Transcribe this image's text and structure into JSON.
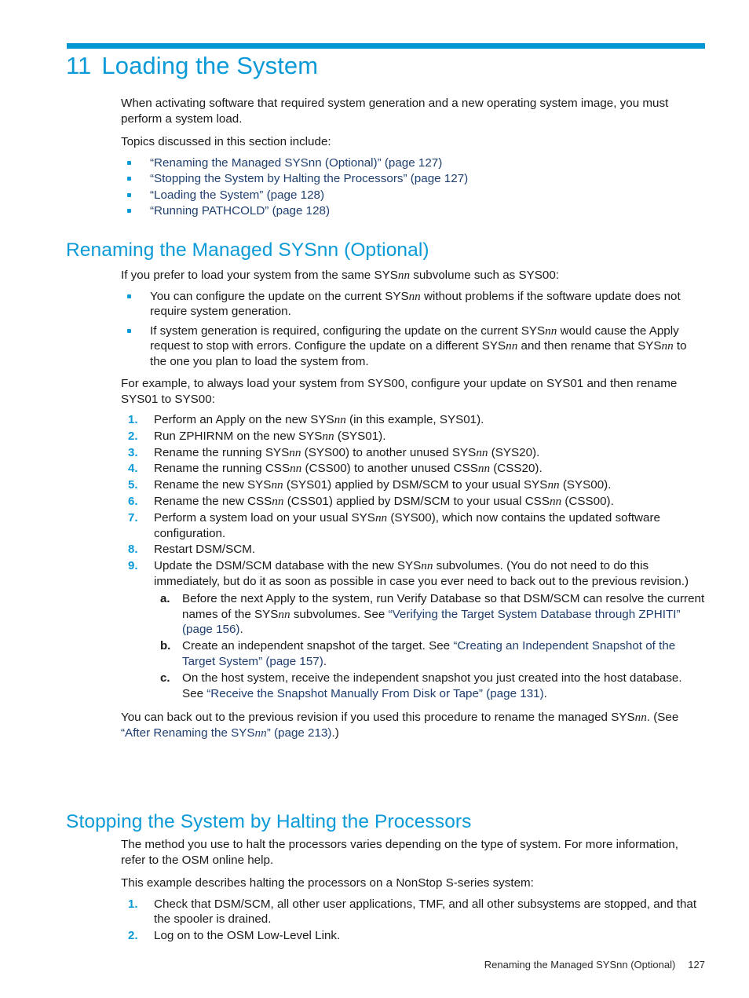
{
  "page": {
    "accent_color": "#0a9ad8",
    "rule_color": "#0096d2",
    "xref_color": "#1f3f6e",
    "body_color": "#1a1a1a"
  },
  "chapter": {
    "number": "11",
    "title": "Loading the System"
  },
  "intro": {
    "paragraph": "When activating software that required system generation and a new operating system image, you must perform a system load.",
    "topics_lead": "Topics discussed in this section include:",
    "topics": [
      "“Renaming the Managed SYSnn (Optional)” (page 127)",
      "“Stopping the System by Halting the Processors” (page 127)",
      "“Loading the System” (page 128)",
      "“Running PATHCOLD” (page 128)"
    ]
  },
  "section_rename": {
    "heading": "Renaming the Managed SYSnn (Optional)",
    "lead_a": "If you prefer to load your system from the same SYS",
    "lead_nn": "nn",
    "lead_b": " subvolume such as SYS00:",
    "bullets": [
      {
        "a": "You can configure the update on the current SYS",
        "nn": "nn",
        "b": " without problems if the software update does not require system generation."
      },
      {
        "a": "If system generation is required, configuring the update on the current SYS",
        "nn": "nn",
        "b": " would cause the Apply request to stop with errors. Configure the update on a different SYS",
        "nn2": "nn",
        "c": " and then rename that SYS",
        "nn3": "nn",
        "d": " to the one you plan to load the system from."
      }
    ],
    "example_paragraph": "For example, to always load your system from SYS00, configure your update on SYS01 and then rename SYS01 to SYS00:",
    "steps": [
      {
        "a": "Perform an Apply on the new SYS",
        "nn": "nn",
        "b": " (in this example, SYS01)."
      },
      {
        "a": "Run ZPHIRNM on the new SYS",
        "nn": "nn",
        "b": " (SYS01)."
      },
      {
        "a": "Rename the running SYS",
        "nn": "nn",
        "b": " (SYS00) to another unused SYS",
        "nn2": "nn",
        "c": " (SYS20)."
      },
      {
        "a": "Rename the running CSS",
        "nn": "nn",
        "b": " (CSS00) to another unused CSS",
        "nn2": "nn",
        "c": " (CSS20)."
      },
      {
        "a": "Rename the new SYS",
        "nn": "nn",
        "b": "  (SYS01) applied by DSM/SCM to your usual SYS",
        "nn2": "nn",
        "c": " (SYS00)."
      },
      {
        "a": "Rename the new CSS",
        "nn": "nn",
        "b": " (CSS01) applied by DSM/SCM to your usual CSS",
        "nn2": "nn",
        "c": " (CSS00)."
      },
      {
        "a": "Perform a system load on your usual SYS",
        "nn": "nn",
        "b": " (SYS00), which now contains the updated software configuration."
      },
      {
        "a": "Restart DSM/SCM.",
        "nn": "",
        "b": ""
      },
      {
        "a": "Update the DSM/SCM database with the new SYS",
        "nn": "nn",
        "b": " subvolumes. (You do not need to do this immediately, but do it as soon as possible in case you ever need to back out to the previous revision.)"
      }
    ],
    "substeps": [
      {
        "a": "Before the next Apply to the system, run Verify Database so that DSM/SCM can resolve the current names of the SYS",
        "nn": "nn",
        "b": " subvolumes. See ",
        "link": "“Verifying the Target System Database through ZPHITI” (page 156)",
        "c": "."
      },
      {
        "a": "Create an independent snapshot of the target. See ",
        "nn": "",
        "b": "",
        "link": "“Creating an Independent Snapshot of the Target System” (page 157)",
        "c": "."
      },
      {
        "a": "On the host system, receive the independent snapshot you just created into the host database. See ",
        "nn": "",
        "b": "",
        "link": "“Receive the Snapshot Manually From Disk or Tape” (page 131)",
        "c": "."
      }
    ],
    "closing": {
      "a": "You can back out to the previous revision if you used this procedure to rename the managed SYS",
      "nn": "nn",
      "b": ". (See ",
      "link_a": "“After Renaming the SYS",
      "link_nn": "nn",
      "link_b": "” (page 213)",
      "c": ".)"
    }
  },
  "section_stop": {
    "heading": "Stopping the System by Halting the Processors",
    "paragraph_1": "The method you use to halt the processors varies depending on the type of system. For more information, refer to the OSM online help.",
    "paragraph_2": "This example describes halting the processors on a NonStop S-series system:",
    "steps": [
      "Check that DSM/SCM, all other user applications, TMF, and all other subsystems are stopped, and that the spooler is drained.",
      "Log on to the OSM Low-Level Link."
    ]
  },
  "footer": {
    "text": "Renaming the Managed SYSnn (Optional)",
    "page_number": "127"
  }
}
